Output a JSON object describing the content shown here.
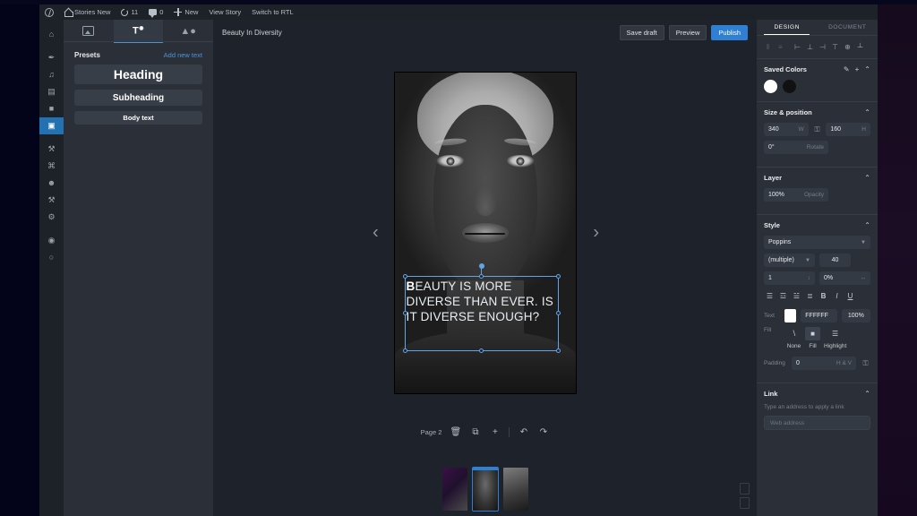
{
  "adminbar": {
    "logo": "wordpress-logo",
    "items": [
      {
        "label": "Stories New",
        "icon": "home-icon"
      },
      {
        "label": "11",
        "icon": "updates-icon"
      },
      {
        "label": "0",
        "icon": "comments-icon"
      },
      {
        "label": "New",
        "icon": "plus-icon"
      },
      {
        "label": "View Story",
        "icon": ""
      },
      {
        "label": "Switch to RTL",
        "icon": ""
      }
    ]
  },
  "rail": {
    "items": [
      {
        "name": "dashboard",
        "glyph": "⌂"
      },
      {
        "name": "posts",
        "glyph": "✒"
      },
      {
        "name": "media",
        "glyph": "♫"
      },
      {
        "name": "pages",
        "glyph": "▤"
      },
      {
        "name": "comments",
        "glyph": "■"
      },
      {
        "name": "stories",
        "glyph": "▣",
        "selected": true
      },
      {
        "name": "appearance",
        "glyph": "⚒"
      },
      {
        "name": "plugins",
        "glyph": "⌘"
      },
      {
        "name": "users",
        "glyph": "☻"
      },
      {
        "name": "tools",
        "glyph": "⚒"
      },
      {
        "name": "settings",
        "glyph": "⚙"
      },
      {
        "name": "collapse",
        "glyph": "◉"
      },
      {
        "name": "help",
        "glyph": "○"
      }
    ]
  },
  "library": {
    "tabs": [
      {
        "label": "media",
        "icon": "image-icon",
        "active": false
      },
      {
        "label": "text",
        "icon": "text-icon",
        "active": true
      },
      {
        "label": "shapes",
        "icon": "shapes-icon",
        "active": false
      }
    ],
    "presets_title": "Presets",
    "add_new_text": "Add new text",
    "presets": [
      {
        "label": "Heading"
      },
      {
        "label": "Subheading"
      },
      {
        "label": "Body text"
      }
    ]
  },
  "workspace": {
    "story_title": "Beauty In Diversity",
    "buttons": {
      "save_draft": "Save draft",
      "preview": "Preview",
      "publish": "Publish"
    },
    "nav": {
      "prev": "‹",
      "next": "›"
    },
    "text_element": {
      "first_letter": "B",
      "rest": "EAUTY IS MORE DIVERSE THAN EVER. IS IT DIVERSE ENOUGH?"
    },
    "pagebar": {
      "page_label": "Page 2",
      "delete": "🗑",
      "duplicate": "⧉",
      "add": "+",
      "undo": "↶",
      "redo": "↷"
    },
    "thumbnails": [
      {
        "name": "page-1",
        "selected": false
      },
      {
        "name": "page-2",
        "selected": true
      },
      {
        "name": "page-3",
        "selected": false
      }
    ]
  },
  "design": {
    "tabs": [
      {
        "label": "DESIGN",
        "active": true
      },
      {
        "label": "DOCUMENT",
        "active": false
      }
    ],
    "align_icons": [
      {
        "name": "distribute-horizontal-icon",
        "glyph": "⦀",
        "dim": true
      },
      {
        "name": "distribute-vertical-icon",
        "glyph": "≡",
        "dim": true
      },
      {
        "name": "align-left-icon",
        "glyph": "⊢"
      },
      {
        "name": "align-center-icon",
        "glyph": "⊥"
      },
      {
        "name": "align-right-icon",
        "glyph": "⊣"
      },
      {
        "name": "align-top-icon",
        "glyph": "⊤"
      },
      {
        "name": "align-middle-icon",
        "glyph": "⊕"
      },
      {
        "name": "align-bottom-icon",
        "glyph": "┴"
      }
    ],
    "saved_colors": {
      "title": "Saved Colors",
      "edit_icon": "✎",
      "add_icon": "+",
      "collapse_icon": "⌃",
      "swatches": [
        "#FFFFFF",
        "#111111"
      ]
    },
    "size_position": {
      "title": "Size & position",
      "collapse_icon": "⌃",
      "width": "340",
      "width_unit": "W",
      "height": "160",
      "height_unit": "H",
      "lock_icon": "🔒",
      "rotate": "0°",
      "rotate_label": "Rotate"
    },
    "layer": {
      "title": "Layer",
      "collapse_icon": "⌃",
      "opacity": "100%",
      "opacity_label": "Opacity"
    },
    "style": {
      "title": "Style",
      "collapse_icon": "⌃",
      "font_family": "Poppins",
      "font_weight": "(multiple)",
      "font_size": "40",
      "line_height": "1",
      "letter_spacing": "0%",
      "align_buttons": [
        {
          "name": "text-align-left-icon",
          "glyph": "☰"
        },
        {
          "name": "text-align-center-icon",
          "glyph": "☲"
        },
        {
          "name": "text-align-right-icon",
          "glyph": "☱"
        },
        {
          "name": "text-align-justify-icon",
          "glyph": "≣"
        }
      ],
      "bold": "B",
      "italic": "I",
      "underline": "U",
      "text_label": "Text",
      "text_color": "FFFFFF",
      "text_opacity": "100%",
      "fill_label": "Fill",
      "fill_options": [
        {
          "label": "None",
          "icon": "no-fill-icon",
          "active": false
        },
        {
          "label": "Fill",
          "icon": "fill-icon",
          "active": true
        },
        {
          "label": "Highlight",
          "icon": "highlight-icon",
          "active": false
        }
      ],
      "padding_label": "Padding",
      "padding_value": "0",
      "padding_unit": "H & V",
      "padding_lock_icon": "🔒"
    },
    "link": {
      "title": "Link",
      "collapse_icon": "⌃",
      "hint": "Type an address to apply a link",
      "placeholder": "Web address",
      "value": ""
    }
  },
  "colors": {
    "accent": "#2f7fd4",
    "panel": "#2b3038",
    "rail": "#1d2128",
    "workspace": "#1e222a",
    "selection": "#61a5e8"
  }
}
